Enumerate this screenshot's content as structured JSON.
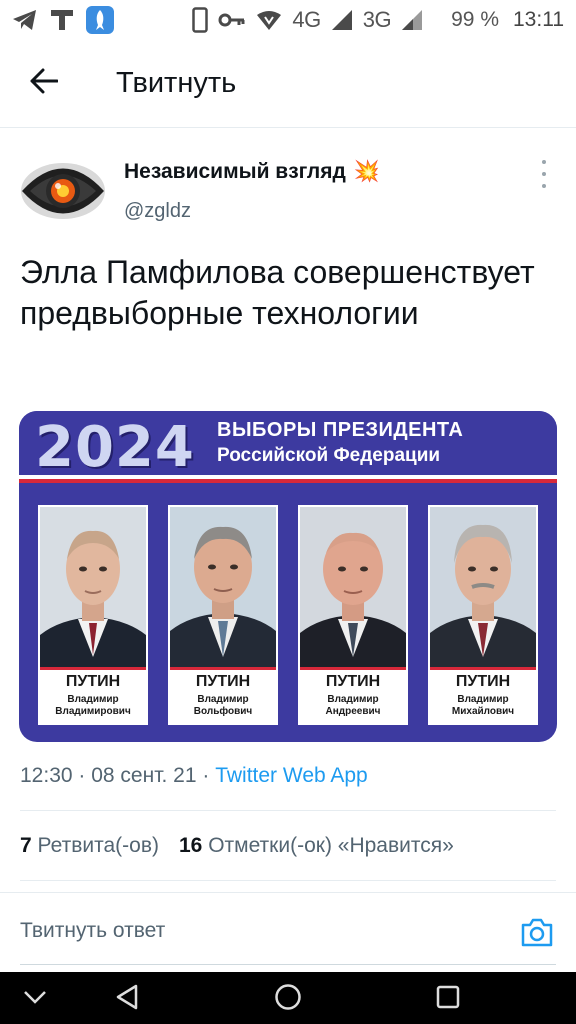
{
  "status_bar": {
    "network_4g": "4G",
    "network_3g": "3G",
    "battery": "99 %",
    "time": "13:11",
    "icons": [
      "telegram-icon",
      "tinkoff-icon",
      "rocket-app-icon",
      "phone-icon",
      "key-icon",
      "vpn-icon",
      "signal-icon"
    ]
  },
  "header": {
    "title": "Твитнуть",
    "back_icon": "arrow-left-icon"
  },
  "tweet": {
    "author_name": "Независимый взгляд",
    "author_emoji": "💥",
    "author_handle": "@zgldz",
    "text": "Элла Памфилова совершенствует предвыборные технологии",
    "media": {
      "year": "2024",
      "title_line1": "ВЫБОРЫ ПРЕЗИДЕНТА",
      "title_line2": "Российской Федерации",
      "colors": {
        "background": "#3d3aa0",
        "accent_red": "#d8283a"
      },
      "candidates": [
        {
          "surname": "ПУТИН",
          "given1": "Владимир",
          "given2": "Владимирович"
        },
        {
          "surname": "ПУТИН",
          "given1": "Владимир",
          "given2": "Вольфович"
        },
        {
          "surname": "ПУТИН",
          "given1": "Владимир",
          "given2": "Андреевич"
        },
        {
          "surname": "ПУТИН",
          "given1": "Владимир",
          "given2": "Михайлович"
        }
      ]
    },
    "time": "12:30",
    "date": "08 сент. 21",
    "source": "Twitter Web App",
    "retweets_count": "7",
    "retweets_label": "Ретвита(-ов)",
    "likes_count": "16",
    "likes_label": "Отметки(-ок) «Нравится»"
  },
  "reply": {
    "placeholder": "Твитнуть ответ",
    "camera_icon": "camera-icon"
  },
  "colors": {
    "accent": "#1d9bf0",
    "text_secondary": "#536471"
  }
}
